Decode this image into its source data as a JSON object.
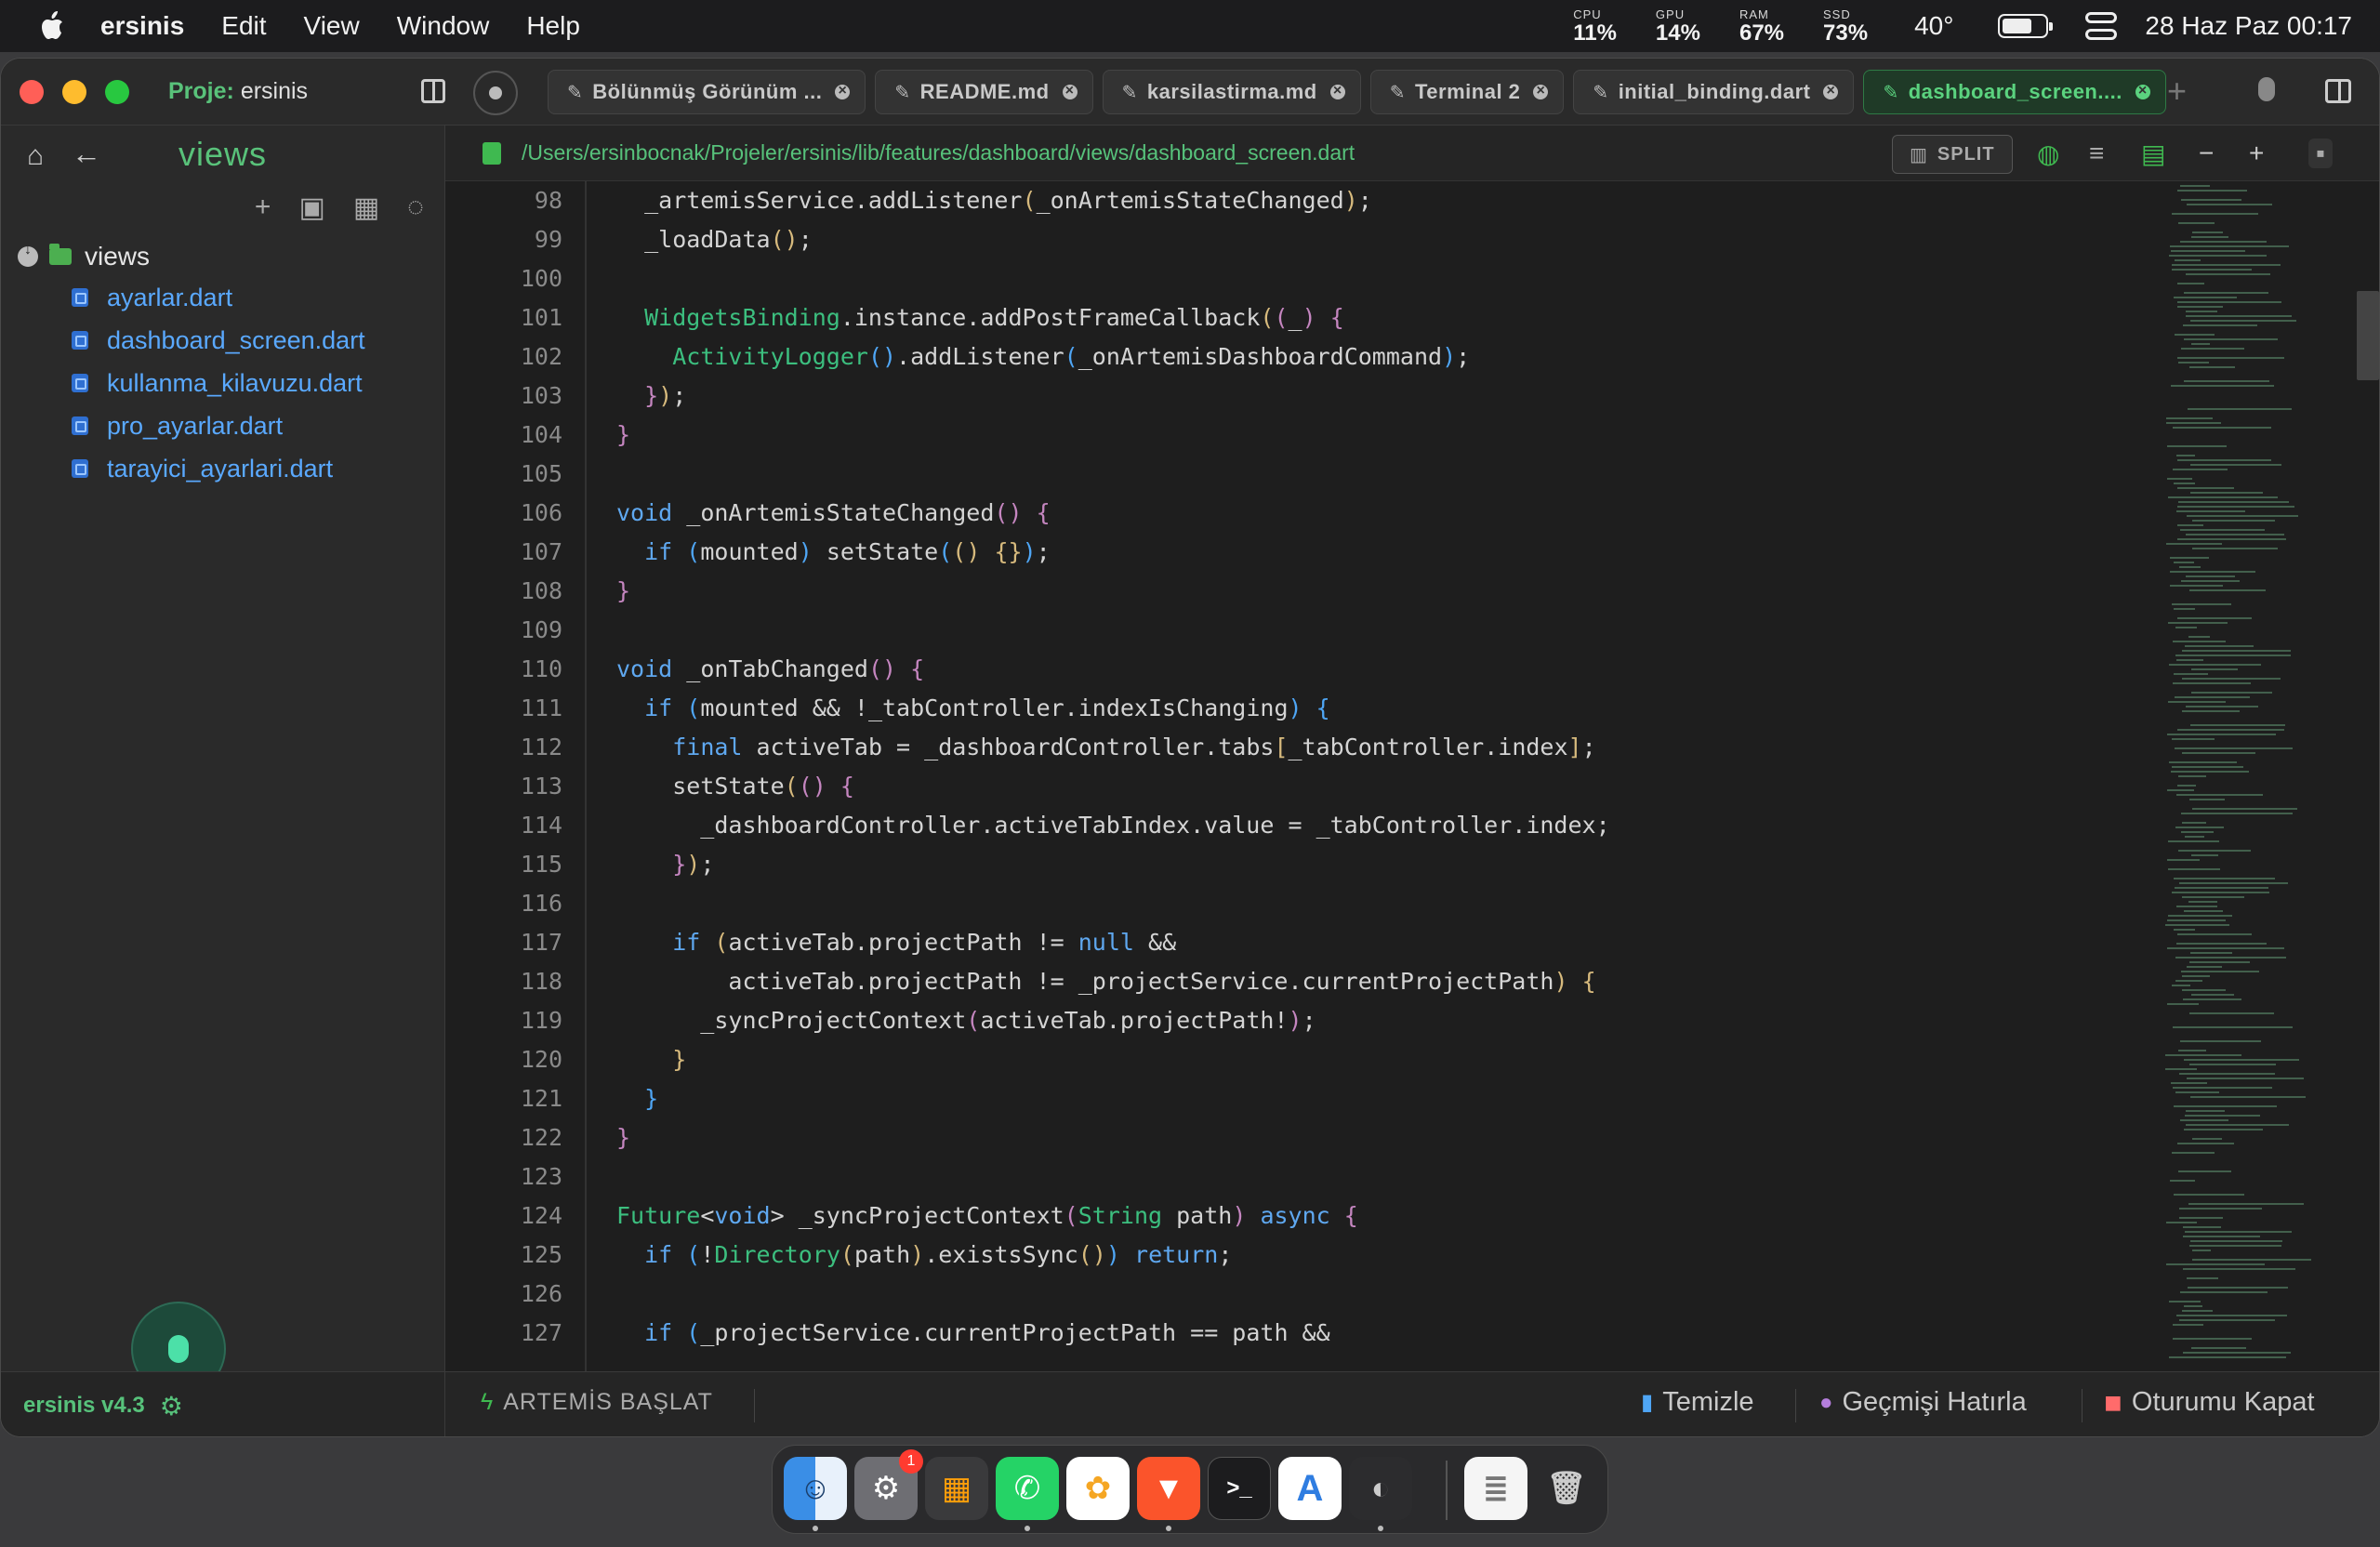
{
  "menubar": {
    "app": "ersinis",
    "items": [
      "Edit",
      "View",
      "Window",
      "Help"
    ],
    "stats": [
      {
        "label": "CPU",
        "value": "11%"
      },
      {
        "label": "GPU",
        "value": "14%"
      },
      {
        "label": "RAM",
        "value": "67%"
      },
      {
        "label": "SSD",
        "value": "73%"
      }
    ],
    "temperature": "40°",
    "battery_level": 0.7,
    "datetime": "28 Haz Paz  00:17"
  },
  "titlebar": {
    "project_prefix": "Proje:",
    "project_name": "ersinis",
    "tabs": [
      {
        "label": "Bölünmüş Görünüm ..."
      },
      {
        "label": "README.md"
      },
      {
        "label": "karsilastirma.md"
      },
      {
        "label": "Terminal 2"
      },
      {
        "label": "initial_binding.dart"
      },
      {
        "label": "dashboard_screen...."
      }
    ],
    "active_tab_index": 5,
    "new_tab": "+"
  },
  "sidebar": {
    "title": "views",
    "root_folder": "views",
    "files": [
      "ayarlar.dart",
      "dashboard_screen.dart",
      "kullanma_kilavuzu.dart",
      "pro_ayarlar.dart",
      "tarayici_ayarlari.dart"
    ]
  },
  "editor": {
    "path": "/Users/ersinbocnak/Projeler/ersinis/lib/features/dashboard/views/dashboard_screen.dart",
    "split_label": "SPLIT",
    "first_line": 98,
    "line_numbers": [
      "98",
      "99",
      "100",
      "101",
      "102",
      "103",
      "104",
      "105",
      "106",
      "107",
      "108",
      "109",
      "110",
      "111",
      "112",
      "113",
      "114",
      "115",
      "116",
      "117",
      "118",
      "119",
      "120",
      "121",
      "122",
      "123",
      "124",
      "125",
      "126",
      "127"
    ]
  },
  "statusbar": {
    "version": "ersinis v4.3",
    "start": "ARTEMİS BAŞLAT",
    "clear": "Temizle",
    "history": "Geçmişi Hatırla",
    "logout": "Oturumu Kapat"
  },
  "dock": {
    "notification_badge": "1",
    "apps": [
      "finder-icon",
      "system-settings-icon",
      "launchpad-icon",
      "whatsapp-icon",
      "photos-icon",
      "brave-icon",
      "terminal-icon",
      "artemis-icon",
      "preview-icon",
      "textedit-icon",
      "trash-icon"
    ]
  },
  "colors": {
    "accent_green": "#57c27b",
    "keyword_blue": "#5fa8f0",
    "file_blue": "#5aa9ff"
  }
}
